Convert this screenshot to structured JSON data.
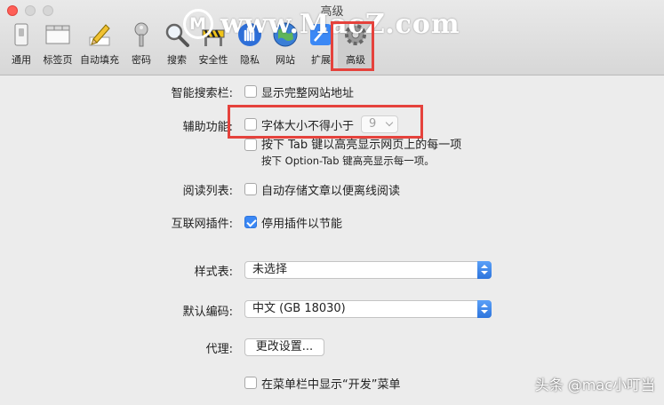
{
  "window": {
    "title": "高级"
  },
  "watermark": {
    "logo": "M",
    "text": "www.MacZ.com"
  },
  "toolbar": {
    "items": [
      {
        "label": "通用"
      },
      {
        "label": "标签页"
      },
      {
        "label": "自动填充"
      },
      {
        "label": "密码"
      },
      {
        "label": "搜索"
      },
      {
        "label": "安全性"
      },
      {
        "label": "隐私"
      },
      {
        "label": "网站"
      },
      {
        "label": "扩展"
      },
      {
        "label": "高级"
      }
    ],
    "selected": "高级"
  },
  "smart_search": {
    "label": "智能搜索栏:",
    "option": "显示完整网站地址",
    "checked": false
  },
  "accessibility": {
    "label": "辅助功能:",
    "option1": "字体大小不得小于",
    "font_size_value": "9",
    "option2": "按下 Tab 键以高亮显示网页上的每一项",
    "option2_note": "按下 Option-Tab 键高亮显示每一项。"
  },
  "reading_list": {
    "label": "阅读列表:",
    "option": "自动存储文章以便离线阅读",
    "checked": false
  },
  "plugins": {
    "label": "互联网插件:",
    "option": "停用插件以节能",
    "checked": true
  },
  "stylesheet": {
    "label": "样式表:",
    "value": "未选择"
  },
  "encoding": {
    "label": "默认编码:",
    "value": "中文 (GB 18030)"
  },
  "proxy": {
    "label": "代理:",
    "button": "更改设置..."
  },
  "develop_menu": {
    "option": "在菜单栏中显示“开发”菜单",
    "checked": false
  },
  "corner_watermark": "头条 @mac小叮当",
  "colors": {
    "accent": "#3b88f5",
    "highlight": "#e5423c"
  }
}
